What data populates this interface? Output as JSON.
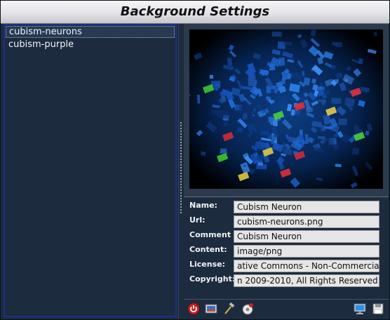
{
  "window": {
    "title": "Background Settings"
  },
  "backgrounds": {
    "items": [
      {
        "label": "cubism-neurons",
        "selected": true
      },
      {
        "label": "cubism-purple",
        "selected": false
      }
    ]
  },
  "properties": {
    "name_label": "Name:",
    "name_value": "Cubism Neuron",
    "url_label": "Url:",
    "url_value": "cubism-neurons.png",
    "comment_label": "Comment",
    "comment_value": "Cubism Neuron",
    "content_label": "Content:",
    "content_value": "image/png",
    "license_label": "License:",
    "license_value": "ative Commons - Non-Commercial",
    "copyright_label": "Copyright:",
    "copyright_value": "n 2009-2010, All Rights Reserved"
  },
  "toolbar": {
    "icons": [
      "power-icon",
      "image-icon",
      "hammer-icon",
      "record-icon",
      "monitor-icon",
      "floppy-icon"
    ]
  },
  "colors": {
    "panel_bg": "#1c2b3e",
    "list_border": "#1c2f8c",
    "preview_blue": "#2a7be0",
    "title_gradient_top": "#f4f4f6"
  }
}
